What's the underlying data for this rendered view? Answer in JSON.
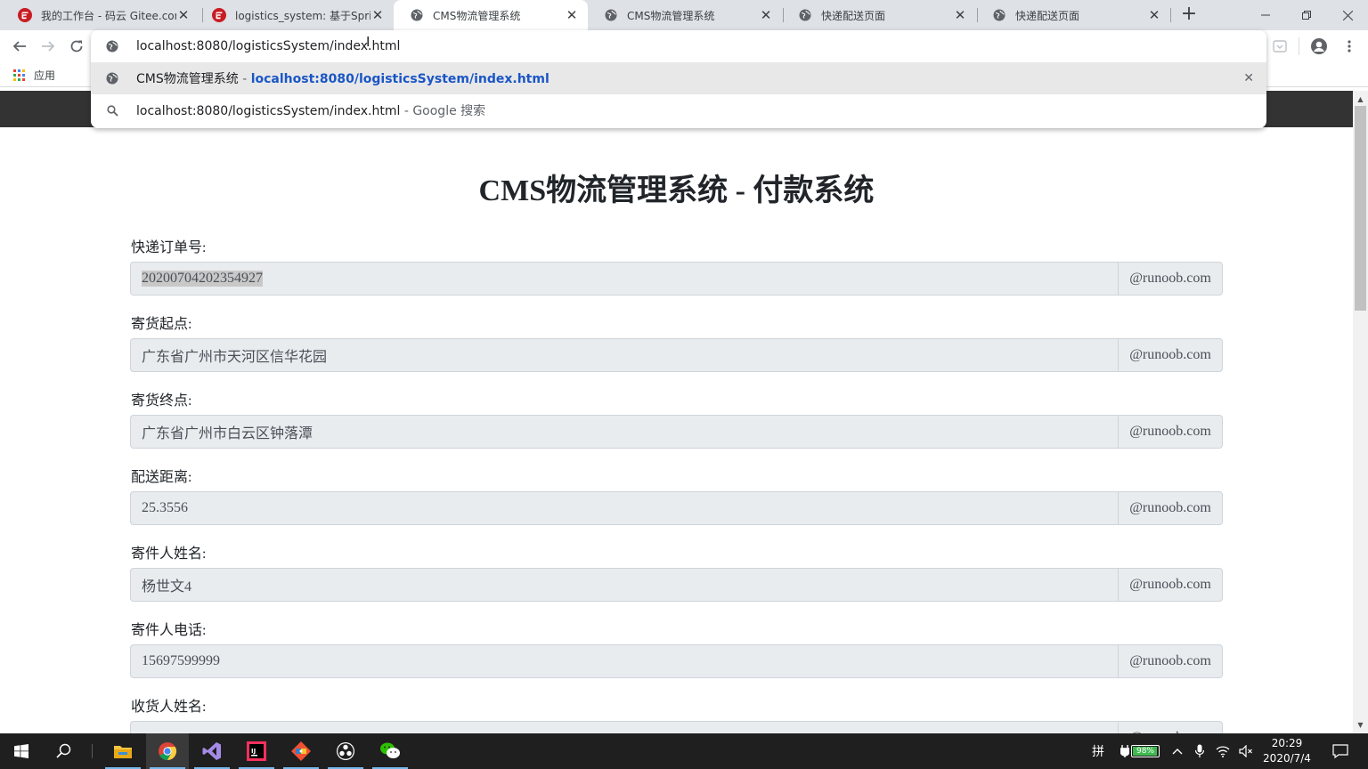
{
  "browser": {
    "tabs": [
      {
        "title": "我的工作台 - 码云 Gitee.com",
        "favicon": "gitee-icon",
        "active": false
      },
      {
        "title": "logistics_system: 基于Spring",
        "favicon": "gitee-icon",
        "active": false
      },
      {
        "title": "CMS物流管理系统",
        "favicon": "globe-icon",
        "active": true
      },
      {
        "title": "CMS物流管理系统",
        "favicon": "globe-icon",
        "active": false
      },
      {
        "title": "快递配送页面",
        "favicon": "globe-icon",
        "active": false
      },
      {
        "title": "快递配送页面",
        "favicon": "globe-icon",
        "active": false
      }
    ],
    "new_tab": "+",
    "omnibox": {
      "value": "localhost:8080/logisticsSystem/index.html",
      "suggestions": [
        {
          "title": "CMS物流管理系统",
          "separator": " - ",
          "url": "localhost:8080/logisticsSystem/index.html",
          "icon": "globe-icon",
          "selected": true,
          "remove": "✕"
        },
        {
          "title": "localhost:8080/logisticsSystem/index.html",
          "separator": " - ",
          "extra": "Google 搜索",
          "icon": "search-icon",
          "selected": false
        }
      ]
    },
    "bookmarks": {
      "apps_label": "应用"
    }
  },
  "page": {
    "title": "CMS物流管理系统 - 付款系统",
    "fields": [
      {
        "label": "快递订单号:",
        "value": "20200704202354927",
        "addon": "@runoob.com",
        "selected": true
      },
      {
        "label": "寄货起点:",
        "value": "广东省广州市天河区信华花园",
        "addon": "@runoob.com"
      },
      {
        "label": "寄货终点:",
        "value": "广东省广州市白云区钟落潭",
        "addon": "@runoob.com"
      },
      {
        "label": "配送距离:",
        "value": "25.3556",
        "addon": "@runoob.com"
      },
      {
        "label": "寄件人姓名:",
        "value": "杨世文4",
        "addon": "@runoob.com"
      },
      {
        "label": "寄件人电话:",
        "value": "15697599999",
        "addon": "@runoob.com"
      },
      {
        "label": "收货人姓名:",
        "value": "",
        "addon": "@runoob.com"
      }
    ]
  },
  "taskbar": {
    "apps": [
      "file-explorer-icon",
      "chrome-icon",
      "visual-studio-icon",
      "intellij-icon",
      "git-icon",
      "obs-icon",
      "wechat-icon"
    ],
    "ime": "拼",
    "battery_percent": "98%",
    "battery_level": 0.98,
    "time": "20:29",
    "date": "2020/7/4"
  }
}
